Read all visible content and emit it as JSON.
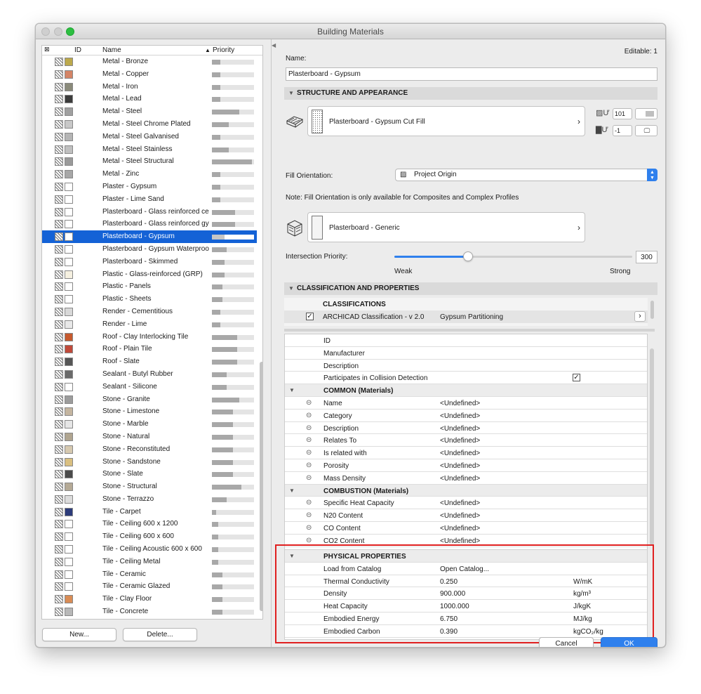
{
  "window": {
    "title": "Building Materials"
  },
  "list": {
    "headers": {
      "id": "ID",
      "name": "Name",
      "priority": "Priority"
    },
    "rows": [
      {
        "name": "Metal - Bronze",
        "priority": 0.2,
        "c1": "#bca94c"
      },
      {
        "name": "Metal - Copper",
        "priority": 0.2,
        "c1": "#d48466"
      },
      {
        "name": "Metal - Iron",
        "priority": 0.2,
        "c1": "#8a8a7a"
      },
      {
        "name": "Metal - Lead",
        "priority": 0.2,
        "c1": "#3c3c3c"
      },
      {
        "name": "Metal - Steel",
        "priority": 0.65,
        "c1": "#a0a0a0"
      },
      {
        "name": "Metal - Steel Chrome Plated",
        "priority": 0.4,
        "c1": "#c8c8c8"
      },
      {
        "name": "Metal - Steel Galvanised",
        "priority": 0.2,
        "c1": "#b5b5b5"
      },
      {
        "name": "Metal - Steel Stainless",
        "priority": 0.4,
        "c1": "#c0c0c0"
      },
      {
        "name": "Metal - Steel Structural",
        "priority": 0.95,
        "c1": "#9a9a9a"
      },
      {
        "name": "Metal - Zinc",
        "priority": 0.2,
        "c1": "#a7a7a7"
      },
      {
        "name": "Plaster - Gypsum",
        "priority": 0.2,
        "c1": "#ffffff"
      },
      {
        "name": "Plaster - Lime Sand",
        "priority": 0.2,
        "c1": "#ffffff"
      },
      {
        "name": "Plasterboard - Glass reinforced ce",
        "priority": 0.55,
        "c1": "#ffffff"
      },
      {
        "name": "Plasterboard - Glass reinforced gy",
        "priority": 0.55,
        "c1": "#ffffff"
      },
      {
        "name": "Plasterboard - Gypsum",
        "priority": 0.3,
        "c1": "#ffffff",
        "selected": true
      },
      {
        "name": "Plasterboard - Gypsum Waterproo",
        "priority": 0.35,
        "c1": "#ffffff"
      },
      {
        "name": "Plasterboard - Skimmed",
        "priority": 0.3,
        "c1": "#ffffff"
      },
      {
        "name": "Plastic - Glass-reinforced (GRP)",
        "priority": 0.3,
        "c1": "#f5f0e0"
      },
      {
        "name": "Plastic - Panels",
        "priority": 0.25,
        "c1": "#ffffff"
      },
      {
        "name": "Plastic - Sheets",
        "priority": 0.25,
        "c1": "#ffffff"
      },
      {
        "name": "Render - Cementitious",
        "priority": 0.2,
        "c1": "#d8d8d8"
      },
      {
        "name": "Render - Lime",
        "priority": 0.2,
        "c1": "#e8e8e8"
      },
      {
        "name": "Roof - Clay Interlocking Tile",
        "priority": 0.6,
        "c1": "#c65a2e"
      },
      {
        "name": "Roof - Plain Tile",
        "priority": 0.6,
        "c1": "#c04a3a"
      },
      {
        "name": "Roof - Slate",
        "priority": 0.6,
        "c1": "#555555"
      },
      {
        "name": "Sealant - Butyl Rubber",
        "priority": 0.35,
        "c1": "#6a6a6a"
      },
      {
        "name": "Sealant - Silicone",
        "priority": 0.35,
        "c1": "#ffffff"
      },
      {
        "name": "Stone - Granite",
        "priority": 0.65,
        "c1": "#9c9c9c"
      },
      {
        "name": "Stone - Limestone",
        "priority": 0.5,
        "c1": "#c4b5a0"
      },
      {
        "name": "Stone - Marble",
        "priority": 0.5,
        "c1": "#e6e6e6"
      },
      {
        "name": "Stone - Natural",
        "priority": 0.5,
        "c1": "#b0a590"
      },
      {
        "name": "Stone - Reconstituted",
        "priority": 0.5,
        "c1": "#d6c9b0"
      },
      {
        "name": "Stone - Sandstone",
        "priority": 0.5,
        "c1": "#d9bf80"
      },
      {
        "name": "Stone - Slate",
        "priority": 0.5,
        "c1": "#4a4a4a"
      },
      {
        "name": "Stone - Structural",
        "priority": 0.7,
        "c1": "#b5aa96"
      },
      {
        "name": "Stone - Terrazzo",
        "priority": 0.35,
        "c1": "#dcdcdc"
      },
      {
        "name": "Tile - Carpet",
        "priority": 0.1,
        "c1": "#2c3b7a"
      },
      {
        "name": "Tile - Ceiling 600 x 1200",
        "priority": 0.15,
        "c1": "#ffffff"
      },
      {
        "name": "Tile - Ceiling 600 x 600",
        "priority": 0.15,
        "c1": "#ffffff"
      },
      {
        "name": "Tile - Ceiling Acoustic 600 x 600",
        "priority": 0.15,
        "c1": "#ffffff"
      },
      {
        "name": "Tile - Ceiling Metal",
        "priority": 0.15,
        "c1": "#ffffff"
      },
      {
        "name": "Tile - Ceramic",
        "priority": 0.25,
        "c1": "#ffffff"
      },
      {
        "name": "Tile - Ceramic Glazed",
        "priority": 0.25,
        "c1": "#ffffff"
      },
      {
        "name": "Tile - Clay Floor",
        "priority": 0.25,
        "c1": "#d98c55"
      },
      {
        "name": "Tile - Concrete",
        "priority": 0.25,
        "c1": "#b8b8b8"
      }
    ],
    "new_label": "New...",
    "delete_label": "Delete..."
  },
  "right": {
    "name_label": "Name:",
    "editable_label": "Editable: 1",
    "name_value": "Plasterboard - Gypsum",
    "structure_header": "STRUCTURE AND APPEARANCE",
    "cut_fill_label": "Plasterboard - Gypsum Cut Fill",
    "pen_value_top": "101",
    "pen_value_bottom": "-1",
    "fill_orientation_label": "Fill Orientation:",
    "fill_orientation_value": "Project Origin",
    "fill_note": "Note: Fill Orientation is only available for Composites and Complex Profiles",
    "surface_label": "Plasterboard - Generic",
    "intersection_label": "Intersection Priority:",
    "intersection_value": "300",
    "intersection_fraction": 0.31,
    "weak_label": "Weak",
    "strong_label": "Strong",
    "class_header": "CLASSIFICATION AND PROPERTIES",
    "classifications_header": "CLASSIFICATIONS",
    "classification_system": "ARCHICAD Classification - v 2.0",
    "classification_value": "Gypsum Partitioning",
    "general_rows": [
      "ID",
      "Manufacturer",
      "Description",
      "Participates in Collision Detection"
    ],
    "common_header": "COMMON (Materials)",
    "common_rows": [
      {
        "name": "Name",
        "value": "<Undefined>"
      },
      {
        "name": "Category",
        "value": "<Undefined>"
      },
      {
        "name": "Description",
        "value": "<Undefined>"
      },
      {
        "name": "Relates To",
        "value": "<Undefined>"
      },
      {
        "name": "Is related with",
        "value": "<Undefined>"
      },
      {
        "name": "Porosity",
        "value": "<Undefined>"
      },
      {
        "name": "Mass Density",
        "value": "<Undefined>"
      }
    ],
    "combustion_header": "COMBUSTION (Materials)",
    "combustion_rows": [
      {
        "name": "Specific Heat Capacity",
        "value": "<Undefined>"
      },
      {
        "name": "N20 Content",
        "value": "<Undefined>"
      },
      {
        "name": "CO Content",
        "value": "<Undefined>"
      },
      {
        "name": "CO2 Content",
        "value": "<Undefined>"
      }
    ],
    "physical_header": "PHYSICAL PROPERTIES",
    "physical_rows": [
      {
        "name": "Load from Catalog",
        "value": "Open Catalog...",
        "unit": ""
      },
      {
        "name": "Thermal Conductivity",
        "value": "0.250",
        "unit": "W/mK"
      },
      {
        "name": "Density",
        "value": "900.000",
        "unit": "kg/m³"
      },
      {
        "name": "Heat Capacity",
        "value": "1000.000",
        "unit": "J/kgK"
      },
      {
        "name": "Embodied Energy",
        "value": "6.750",
        "unit": "MJ/kg"
      },
      {
        "name": "Embodied Carbon",
        "value": "0.390",
        "unit": "kgCO₂/kg"
      }
    ],
    "cancel_label": "Cancel",
    "ok_label": "OK"
  },
  "colors": {
    "accent": "#1462d6",
    "ok": "#2f80ed",
    "highlight": "#e02020"
  }
}
